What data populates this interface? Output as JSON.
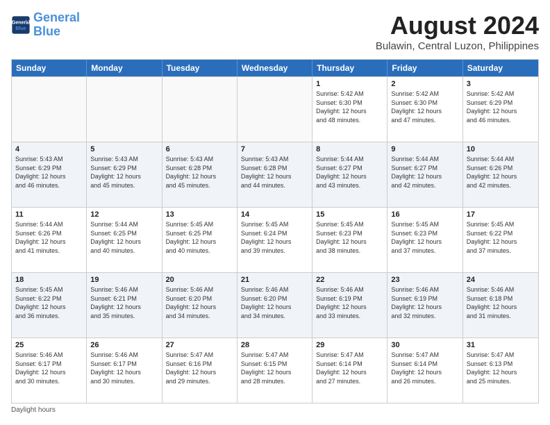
{
  "logo": {
    "line1": "General",
    "line2": "Blue"
  },
  "title": "August 2024",
  "location": "Bulawin, Central Luzon, Philippines",
  "days_of_week": [
    "Sunday",
    "Monday",
    "Tuesday",
    "Wednesday",
    "Thursday",
    "Friday",
    "Saturday"
  ],
  "weeks": [
    [
      {
        "day": "",
        "content": ""
      },
      {
        "day": "",
        "content": ""
      },
      {
        "day": "",
        "content": ""
      },
      {
        "day": "",
        "content": ""
      },
      {
        "day": "1",
        "content": "Sunrise: 5:42 AM\nSunset: 6:30 PM\nDaylight: 12 hours\nand 48 minutes."
      },
      {
        "day": "2",
        "content": "Sunrise: 5:42 AM\nSunset: 6:30 PM\nDaylight: 12 hours\nand 47 minutes."
      },
      {
        "day": "3",
        "content": "Sunrise: 5:42 AM\nSunset: 6:29 PM\nDaylight: 12 hours\nand 46 minutes."
      }
    ],
    [
      {
        "day": "4",
        "content": "Sunrise: 5:43 AM\nSunset: 6:29 PM\nDaylight: 12 hours\nand 46 minutes."
      },
      {
        "day": "5",
        "content": "Sunrise: 5:43 AM\nSunset: 6:29 PM\nDaylight: 12 hours\nand 45 minutes."
      },
      {
        "day": "6",
        "content": "Sunrise: 5:43 AM\nSunset: 6:28 PM\nDaylight: 12 hours\nand 45 minutes."
      },
      {
        "day": "7",
        "content": "Sunrise: 5:43 AM\nSunset: 6:28 PM\nDaylight: 12 hours\nand 44 minutes."
      },
      {
        "day": "8",
        "content": "Sunrise: 5:44 AM\nSunset: 6:27 PM\nDaylight: 12 hours\nand 43 minutes."
      },
      {
        "day": "9",
        "content": "Sunrise: 5:44 AM\nSunset: 6:27 PM\nDaylight: 12 hours\nand 42 minutes."
      },
      {
        "day": "10",
        "content": "Sunrise: 5:44 AM\nSunset: 6:26 PM\nDaylight: 12 hours\nand 42 minutes."
      }
    ],
    [
      {
        "day": "11",
        "content": "Sunrise: 5:44 AM\nSunset: 6:26 PM\nDaylight: 12 hours\nand 41 minutes."
      },
      {
        "day": "12",
        "content": "Sunrise: 5:44 AM\nSunset: 6:25 PM\nDaylight: 12 hours\nand 40 minutes."
      },
      {
        "day": "13",
        "content": "Sunrise: 5:45 AM\nSunset: 6:25 PM\nDaylight: 12 hours\nand 40 minutes."
      },
      {
        "day": "14",
        "content": "Sunrise: 5:45 AM\nSunset: 6:24 PM\nDaylight: 12 hours\nand 39 minutes."
      },
      {
        "day": "15",
        "content": "Sunrise: 5:45 AM\nSunset: 6:23 PM\nDaylight: 12 hours\nand 38 minutes."
      },
      {
        "day": "16",
        "content": "Sunrise: 5:45 AM\nSunset: 6:23 PM\nDaylight: 12 hours\nand 37 minutes."
      },
      {
        "day": "17",
        "content": "Sunrise: 5:45 AM\nSunset: 6:22 PM\nDaylight: 12 hours\nand 37 minutes."
      }
    ],
    [
      {
        "day": "18",
        "content": "Sunrise: 5:45 AM\nSunset: 6:22 PM\nDaylight: 12 hours\nand 36 minutes."
      },
      {
        "day": "19",
        "content": "Sunrise: 5:46 AM\nSunset: 6:21 PM\nDaylight: 12 hours\nand 35 minutes."
      },
      {
        "day": "20",
        "content": "Sunrise: 5:46 AM\nSunset: 6:20 PM\nDaylight: 12 hours\nand 34 minutes."
      },
      {
        "day": "21",
        "content": "Sunrise: 5:46 AM\nSunset: 6:20 PM\nDaylight: 12 hours\nand 34 minutes."
      },
      {
        "day": "22",
        "content": "Sunrise: 5:46 AM\nSunset: 6:19 PM\nDaylight: 12 hours\nand 33 minutes."
      },
      {
        "day": "23",
        "content": "Sunrise: 5:46 AM\nSunset: 6:19 PM\nDaylight: 12 hours\nand 32 minutes."
      },
      {
        "day": "24",
        "content": "Sunrise: 5:46 AM\nSunset: 6:18 PM\nDaylight: 12 hours\nand 31 minutes."
      }
    ],
    [
      {
        "day": "25",
        "content": "Sunrise: 5:46 AM\nSunset: 6:17 PM\nDaylight: 12 hours\nand 30 minutes."
      },
      {
        "day": "26",
        "content": "Sunrise: 5:46 AM\nSunset: 6:17 PM\nDaylight: 12 hours\nand 30 minutes."
      },
      {
        "day": "27",
        "content": "Sunrise: 5:47 AM\nSunset: 6:16 PM\nDaylight: 12 hours\nand 29 minutes."
      },
      {
        "day": "28",
        "content": "Sunrise: 5:47 AM\nSunset: 6:15 PM\nDaylight: 12 hours\nand 28 minutes."
      },
      {
        "day": "29",
        "content": "Sunrise: 5:47 AM\nSunset: 6:14 PM\nDaylight: 12 hours\nand 27 minutes."
      },
      {
        "day": "30",
        "content": "Sunrise: 5:47 AM\nSunset: 6:14 PM\nDaylight: 12 hours\nand 26 minutes."
      },
      {
        "day": "31",
        "content": "Sunrise: 5:47 AM\nSunset: 6:13 PM\nDaylight: 12 hours\nand 25 minutes."
      }
    ]
  ],
  "footer": "Daylight hours"
}
